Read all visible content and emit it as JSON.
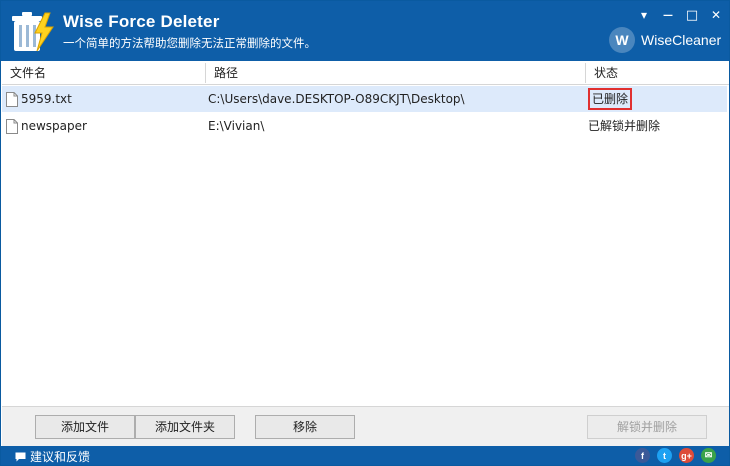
{
  "app": {
    "title": "Wise Force Deleter",
    "subtitle": "一个简单的方法帮助您删除无法正常删除的文件。",
    "brand": "WiseCleaner",
    "brand_logo_letter": "W"
  },
  "window_controls": {
    "menu": "▾",
    "minimize": "—",
    "maximize": "□",
    "close": "✕"
  },
  "list": {
    "columns": [
      "文件名",
      "路径",
      "状态"
    ],
    "rows": [
      {
        "name": "5959.txt",
        "path": "C:\\Users\\dave.DESKTOP-O89CKJT\\Desktop\\",
        "status": "已删除",
        "selected": true
      },
      {
        "name": "newspaper",
        "path": "E:\\Vivian\\",
        "status": "已解锁并删除",
        "selected": false
      }
    ]
  },
  "buttons": {
    "add_file": "添加文件",
    "add_folder": "添加文件夹",
    "remove": "移除",
    "unlock_delete": "解锁并删除"
  },
  "statusbar": {
    "feedback": "建议和反馈",
    "social": {
      "facebook": "f",
      "twitter": "t",
      "googleplus": "g+",
      "mail": "✉"
    }
  },
  "colors": {
    "titlebar": "#0e5ea8",
    "selected_row": "#ddeafb",
    "highlight_box": "#e03030"
  }
}
